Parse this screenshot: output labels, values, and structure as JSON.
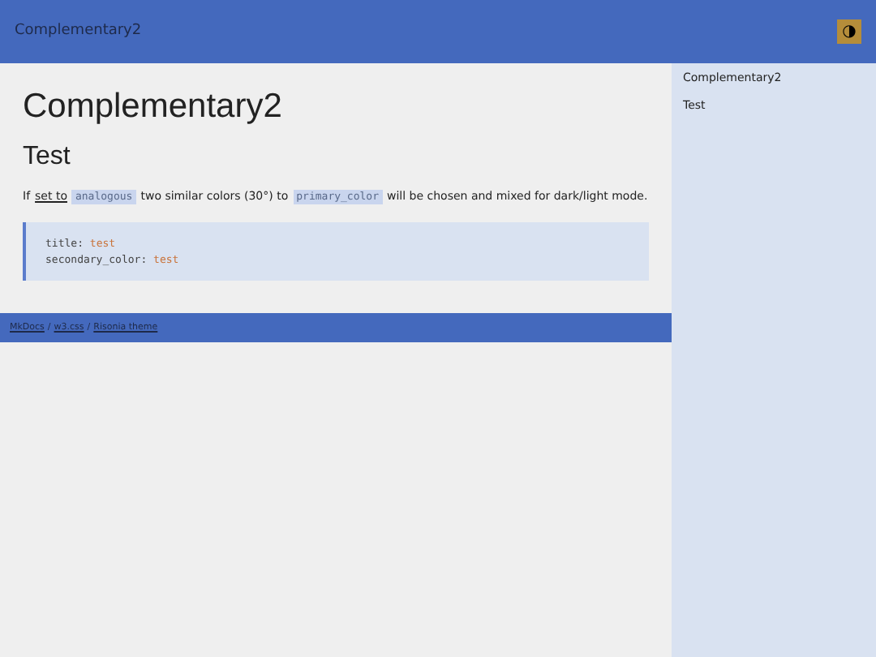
{
  "header": {
    "title": "Complementary2",
    "theme_toggle": "◑"
  },
  "main": {
    "title": "Complementary2",
    "subtitle": "Test",
    "paragraph": [
      {
        "kind": "text",
        "text": "If"
      },
      {
        "kind": "link",
        "text": "set to"
      },
      {
        "kind": "code",
        "text": "analogous"
      },
      {
        "kind": "text",
        "text": "two similar colors (30°) to"
      },
      {
        "kind": "code",
        "text": "primary_color"
      },
      {
        "kind": "text",
        "text": "will be chosen and mixed for dark/light mode."
      }
    ],
    "code_block": [
      {
        "key": "title:",
        "value": "test"
      },
      {
        "key": "secondary_color:",
        "value": "test"
      }
    ]
  },
  "footer": {
    "links": [
      {
        "kind": "link",
        "text": "MkDocs"
      },
      {
        "kind": "sep",
        "text": "/"
      },
      {
        "kind": "link",
        "text": "w3.css"
      },
      {
        "kind": "sep",
        "text": "/"
      },
      {
        "kind": "link",
        "text": "Risonia theme"
      }
    ]
  },
  "sidebar": {
    "items": [
      {
        "label": "Complementary2"
      },
      {
        "label": "Test"
      }
    ]
  }
}
